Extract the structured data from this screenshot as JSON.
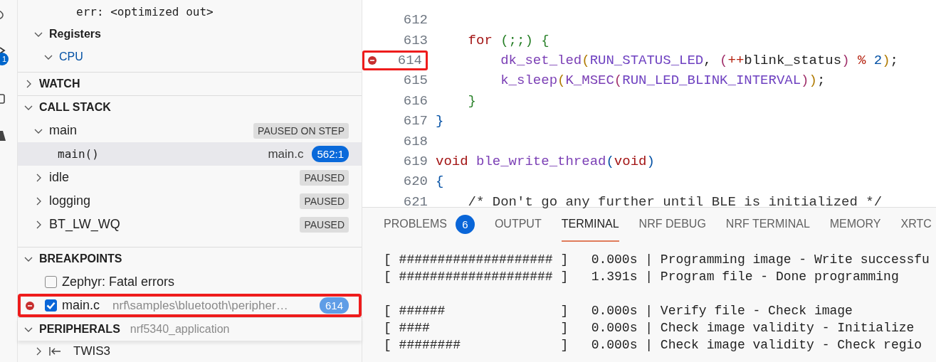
{
  "activity_bar": {
    "badge": "1"
  },
  "variables": {
    "items": [
      {
        "kind": "value",
        "text": "err: <optimized out>"
      },
      {
        "kind": "group",
        "text": "Registers",
        "expanded": true
      },
      {
        "kind": "subgroup",
        "text": "CPU",
        "expanded": true
      }
    ]
  },
  "watch": {
    "title": "WATCH",
    "expanded": false
  },
  "call_stack": {
    "title": "CALL STACK",
    "expanded": true,
    "threads": [
      {
        "name": "main",
        "status": "PAUSED ON STEP",
        "expanded": true,
        "frames": [
          {
            "function": "main()",
            "file": "main.c",
            "position": "562:1",
            "selected": true
          }
        ]
      },
      {
        "name": "idle",
        "status": "PAUSED",
        "expanded": false
      },
      {
        "name": "logging",
        "status": "PAUSED",
        "expanded": false
      },
      {
        "name": "BT_LW_WQ",
        "status": "PAUSED",
        "expanded": false
      }
    ]
  },
  "breakpoints": {
    "title": "BREAKPOINTS",
    "expanded": true,
    "items": [
      {
        "kind": "exception",
        "label": "Zephyr: Fatal errors",
        "checked": false,
        "highlighted": false
      },
      {
        "kind": "source",
        "label": "main.c",
        "path": "nrf\\samples\\bluetooth\\peripher…",
        "line": "614",
        "checked": true,
        "highlighted": true
      }
    ]
  },
  "peripherals": {
    "title": "PERIPHERALS",
    "description": "nrf5340_application",
    "expanded": true,
    "items": [
      {
        "name": "TWIS3"
      }
    ]
  },
  "editor": {
    "lines": [
      {
        "number": "612",
        "breakpoint": false,
        "highlighted": false
      },
      {
        "number": "613",
        "breakpoint": false,
        "highlighted": false,
        "tokens": [
          {
            "kind": "kw",
            "text": "    for "
          },
          {
            "kind": "br2",
            "text": "(;;) {"
          }
        ]
      },
      {
        "number": "614",
        "breakpoint": true,
        "highlighted": true,
        "tokens": [
          {
            "kind": "fn",
            "text": "        dk_set_led"
          },
          {
            "kind": "br3",
            "text": "("
          },
          {
            "kind": "mac",
            "text": "RUN_STATUS_LED"
          },
          {
            "kind": "plain",
            "text": ", "
          },
          {
            "kind": "br4",
            "text": "("
          },
          {
            "kind": "op",
            "text": "++"
          },
          {
            "kind": "plain",
            "text": "blink_status"
          },
          {
            "kind": "br4",
            "text": ")"
          },
          {
            "kind": "op",
            "text": " % "
          },
          {
            "kind": "num",
            "text": "2"
          },
          {
            "kind": "br3",
            "text": ")"
          },
          {
            "kind": "plain",
            "text": ";"
          }
        ]
      },
      {
        "number": "615",
        "breakpoint": false,
        "highlighted": false,
        "tokens": [
          {
            "kind": "fn",
            "text": "        k_sleep"
          },
          {
            "kind": "br3",
            "text": "("
          },
          {
            "kind": "fn",
            "text": "K_MSEC"
          },
          {
            "kind": "br4",
            "text": "("
          },
          {
            "kind": "mac",
            "text": "RUN_LED_BLINK_INTERVAL"
          },
          {
            "kind": "br4",
            "text": ")"
          },
          {
            "kind": "br3",
            "text": ")"
          },
          {
            "kind": "plain",
            "text": ";"
          }
        ]
      },
      {
        "number": "616",
        "breakpoint": false,
        "highlighted": false,
        "tokens": [
          {
            "kind": "br2",
            "text": "    }"
          }
        ]
      },
      {
        "number": "617",
        "breakpoint": false,
        "highlighted": false,
        "tokens": [
          {
            "kind": "br1",
            "text": "}"
          }
        ]
      },
      {
        "number": "618",
        "breakpoint": false,
        "highlighted": false
      },
      {
        "number": "619",
        "breakpoint": false,
        "highlighted": false,
        "tokens": [
          {
            "kind": "kw",
            "text": "void "
          },
          {
            "kind": "fn",
            "text": "ble_write_thread"
          },
          {
            "kind": "br1",
            "text": "("
          },
          {
            "kind": "kw",
            "text": "void"
          },
          {
            "kind": "br1",
            "text": ")"
          }
        ]
      },
      {
        "number": "620",
        "breakpoint": false,
        "highlighted": false,
        "tokens": [
          {
            "kind": "br1",
            "text": "{"
          }
        ]
      },
      {
        "number": "621",
        "breakpoint": false,
        "highlighted": false,
        "tokens": [
          {
            "kind": "cm",
            "text": "    /* Don't go any further until BLE is initialized */"
          }
        ]
      }
    ]
  },
  "panel": {
    "tabs": [
      {
        "label": "PROBLEMS",
        "badge": "6",
        "selected": false
      },
      {
        "label": "OUTPUT",
        "selected": false
      },
      {
        "label": "TERMINAL",
        "selected": true
      },
      {
        "label": "NRF DEBUG",
        "selected": false
      },
      {
        "label": "NRF TERMINAL",
        "selected": false
      },
      {
        "label": "MEMORY",
        "selected": false
      },
      {
        "label": "XRTC",
        "selected": false
      }
    ],
    "terminal_lines": [
      {
        "text": "[ #################### ]   0.000s | Programming image - Write successfu",
        "blank_before": false
      },
      {
        "text": "[ #################### ]   1.391s | Program file - Done programming",
        "blank_before": false
      },
      {
        "text": "[ ######               ]   0.000s | Verify file - Check image",
        "blank_before": true
      },
      {
        "text": "[ ####                 ]   0.000s | Check image validity - Initialize",
        "blank_before": false
      },
      {
        "text": "[ ########             ]   0.000s | Check image validity - Check regio",
        "blank_before": false
      }
    ]
  }
}
